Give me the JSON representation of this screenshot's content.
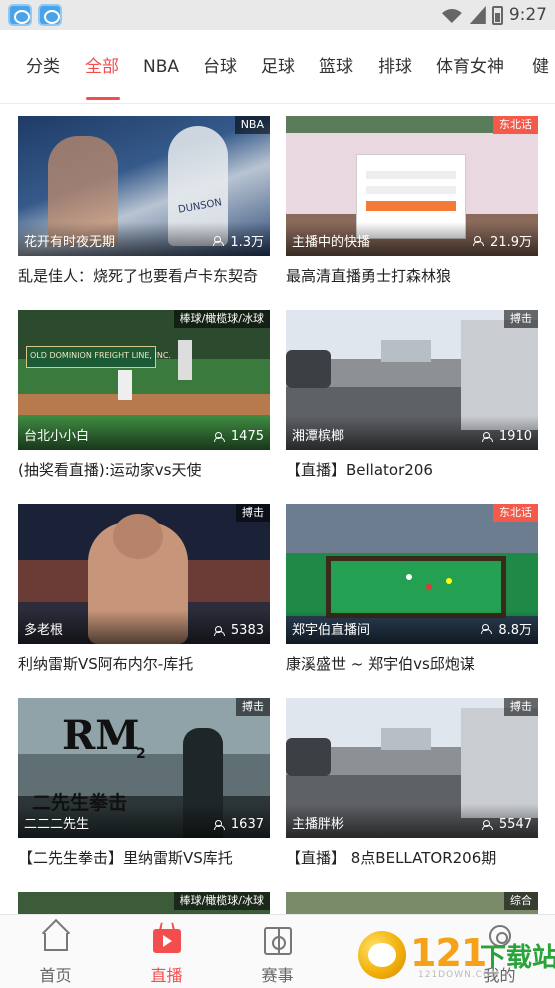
{
  "status_bar": {
    "time": "9:27",
    "app_icons": [
      "rox-app-icon",
      "rox-app-icon"
    ]
  },
  "tabs": [
    {
      "label": "分类",
      "active": false
    },
    {
      "label": "全部",
      "active": true
    },
    {
      "label": "NBA",
      "active": false
    },
    {
      "label": "台球",
      "active": false
    },
    {
      "label": "足球",
      "active": false
    },
    {
      "label": "篮球",
      "active": false
    },
    {
      "label": "排球",
      "active": false
    },
    {
      "label": "体育女神",
      "active": false
    },
    {
      "label": "健",
      "active": false
    }
  ],
  "accent_color": "#f34d4d",
  "cards": [
    {
      "category": "NBA",
      "host": "花开有时夜无期",
      "viewers": "1.3万",
      "title": "乱是佳人：烧死了也要看卢卡东契奇",
      "badge_style": "dark"
    },
    {
      "category": "东北话",
      "host": "主播中的快播",
      "viewers": "21.9万",
      "title": "最高清直播勇士打森林狼",
      "badge_style": "red"
    },
    {
      "category": "棒球/橄榄球/冰球",
      "host": "台北小小白",
      "viewers": "1475",
      "title": "(抽奖看直播):运动家vs天使",
      "badge_style": "dark"
    },
    {
      "category": "搏击",
      "host": "湘潭槟榔",
      "viewers": "1910",
      "title": "【直播】Bellator206",
      "badge_style": "dark"
    },
    {
      "category": "搏击",
      "host": "多老根",
      "viewers": "5383",
      "title": "利纳雷斯VS阿布内尔-库托",
      "badge_style": "dark"
    },
    {
      "category": "东北话",
      "host": "郑宇伯直播间",
      "viewers": "8.8万",
      "title": "康溪盛世 ~ 郑宇伯vs邱炮谋",
      "badge_style": "red"
    },
    {
      "category": "搏击",
      "host": "二二二先生",
      "viewers": "1637",
      "title": "【二先生拳击】里纳雷斯VS库托",
      "badge_style": "dark"
    },
    {
      "category": "搏击",
      "host": "主播胖彬",
      "viewers": "5547",
      "title": "【直播】 8点BELLATOR206期",
      "badge_style": "dark"
    },
    {
      "category": "棒球/橄榄球/冰球",
      "host": "",
      "viewers": "",
      "title": "",
      "badge_style": "dark"
    },
    {
      "category": "综合",
      "host": "",
      "viewers": "",
      "title": "",
      "badge_style": "dark"
    }
  ],
  "thumbnail_overlays": {
    "nba_jersey": "DUNSON",
    "baseball_banner": "OLD DOMINION FREIGHT LINE, INC.",
    "rm_logo": "RM",
    "rm_sub": "2",
    "rm_caption": "二先生拳击"
  },
  "bottom_nav": [
    {
      "label": "首页",
      "icon": "home-icon",
      "active": false
    },
    {
      "label": "直播",
      "icon": "live-tv-icon",
      "active": true
    },
    {
      "label": "赛事",
      "icon": "field-icon",
      "active": false
    },
    {
      "label": "",
      "icon": "hot-icon",
      "active": false
    },
    {
      "label": "我的",
      "icon": "profile-icon",
      "active": false
    }
  ],
  "watermark": {
    "number": "121",
    "text": "下载站",
    "sub": "121DOWN.COM"
  }
}
